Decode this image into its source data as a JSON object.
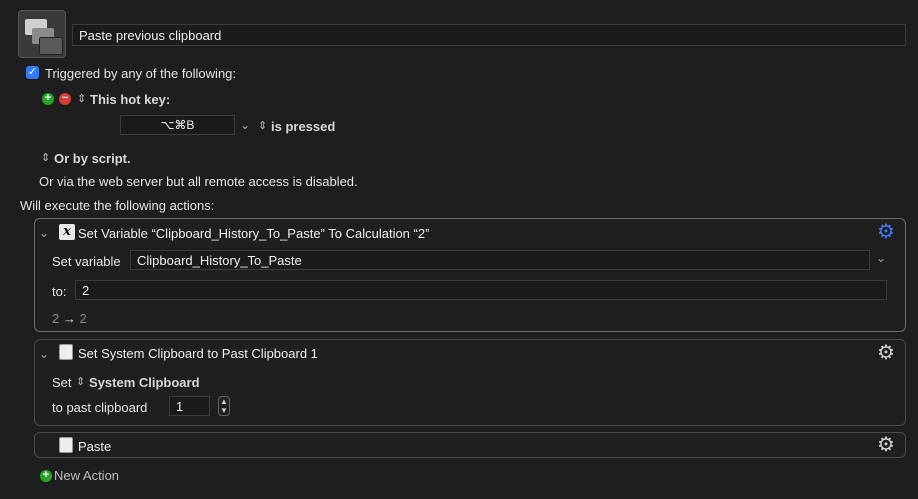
{
  "macro": {
    "name": "Paste previous clipboard",
    "icon": "clipboard-stack-icon"
  },
  "trigger": {
    "checked": true,
    "label": "Triggered by any of the following:",
    "hotkey_label": "This hot key:",
    "hotkey_value": "⌥⌘B",
    "pressed_label": "is pressed",
    "script_label": "Or by script.",
    "web_label": "Or via the web server but all remote access is disabled."
  },
  "actions_header": "Will execute the following actions:",
  "actions": [
    {
      "title": "Set Variable “Clipboard_History_To_Paste” To Calculation “2”",
      "set_variable_label": "Set variable",
      "variable_name": "Clipboard_History_To_Paste",
      "to_label": "to:",
      "to_value": "2",
      "preview_left": "2",
      "preview_arrow": "→",
      "preview_right": "2"
    },
    {
      "title": "Set System Clipboard to Past Clipboard 1",
      "set_label": "Set",
      "clipboard_option": "System Clipboard",
      "past_label": "to past clipboard",
      "past_value": "1"
    },
    {
      "title": "Paste"
    }
  ],
  "new_action_label": "New Action",
  "colors": {
    "background": "#1e1e1e",
    "accent": "#2f7cf6",
    "add": "#29a329",
    "remove": "#d93a3a"
  }
}
